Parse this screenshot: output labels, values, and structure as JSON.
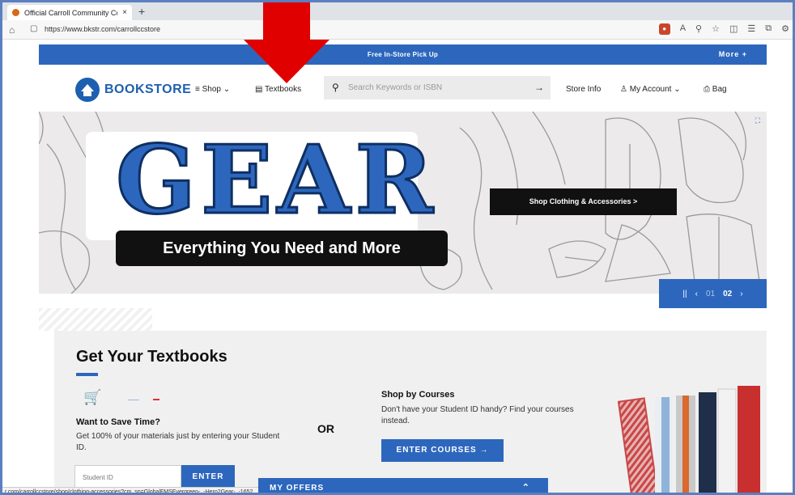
{
  "browser": {
    "tab_title": "Official Carroll Community Colle",
    "tab_close": "×",
    "new_tab": "+",
    "url": "https://www.bkstr.com/carrollccstore",
    "status_url": "r.com/carrollccstore/shop/clothing-accessories?cm_sp=GlobalFMSEvergreen-_-Hero2Gear-_-1652"
  },
  "promo": {
    "text": "Free In-Store Pick Up",
    "more": "More  +"
  },
  "nav": {
    "logo": "BOOKSTORE",
    "shop": "Shop",
    "textbooks": "Textbooks",
    "search_placeholder": "Search Keywords or ISBN",
    "store_info": "Store Info",
    "my_account": "My Account",
    "bag": "Bag"
  },
  "hero": {
    "headline": "GEAR",
    "tagline": "Everything You Need and More",
    "cta": "Shop Clothing & Accessories >",
    "slide_prev": "01",
    "slide_current": "02"
  },
  "textbooks": {
    "title": "Get Your Textbooks",
    "save_title": "Want to Save Time?",
    "save_text": "Get 100% of your materials just by entering your Student ID.",
    "student_placeholder": "Student ID",
    "enter": "ENTER",
    "or": "OR",
    "courses_title": "Shop by Courses",
    "courses_text": "Don't have your Student ID handy? Find your courses instead.",
    "enter_courses": "ENTER COURSES →",
    "offers": "MY OFFERS"
  },
  "colors": {
    "brand_blue": "#2d67bd",
    "annotation_red": "#e00000"
  }
}
